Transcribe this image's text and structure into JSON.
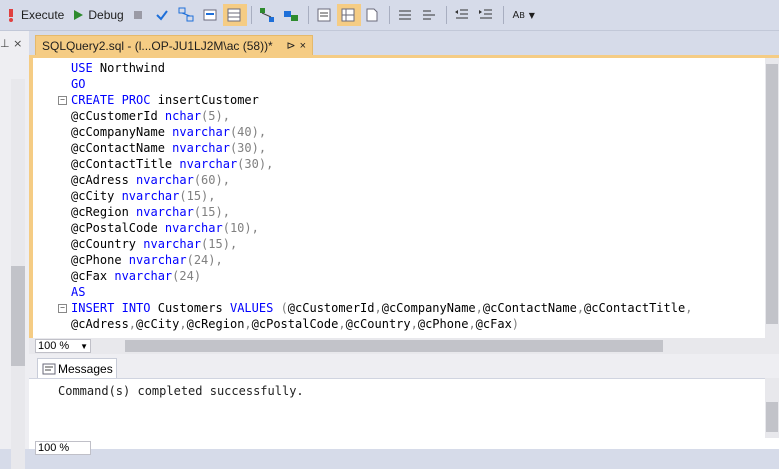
{
  "toolbar": {
    "execute_label": "Execute",
    "debug_label": "Debug",
    "icons": [
      "execute-icon",
      "debug-icon",
      "stop-icon",
      "parse-icon",
      "results-to-text-icon",
      "results-to-grid-icon",
      "results-to-file-icon",
      "include-plan-icon",
      "display-plan-icon",
      "query-options-icon",
      "intellisense-icon",
      "comment-icon",
      "uncomment-icon",
      "decrease-indent-icon",
      "increase-indent-icon",
      "specify-values-icon"
    ]
  },
  "tab": {
    "title": "SQLQuery2.sql - (l...OP-JU1LJ2M\\ac (58))*",
    "pin_glyph": "⊳",
    "close_glyph": "×"
  },
  "left_panel": {
    "header_glyphs": "⊥ ×"
  },
  "editor": {
    "lines": [
      {
        "fold": "",
        "parts": [
          {
            "t": "USE",
            "c": "kw"
          },
          {
            "t": " Northwind",
            "c": "id"
          }
        ]
      },
      {
        "fold": "",
        "parts": [
          {
            "t": "GO",
            "c": "kw"
          }
        ]
      },
      {
        "fold": "−",
        "parts": [
          {
            "t": "CREATE",
            "c": "kw"
          },
          {
            "t": " ",
            "c": "id"
          },
          {
            "t": "PROC",
            "c": "kw"
          },
          {
            "t": " insertCustomer",
            "c": "id"
          }
        ]
      },
      {
        "fold": "",
        "parts": [
          {
            "t": "@cCustomerId ",
            "c": "id"
          },
          {
            "t": "nchar",
            "c": "ty"
          },
          {
            "t": "(5),",
            "c": "pu"
          }
        ]
      },
      {
        "fold": "",
        "parts": [
          {
            "t": "@cCompanyName ",
            "c": "id"
          },
          {
            "t": "nvarchar",
            "c": "ty"
          },
          {
            "t": "(40),",
            "c": "pu"
          }
        ]
      },
      {
        "fold": "",
        "parts": [
          {
            "t": "@cContactName ",
            "c": "id"
          },
          {
            "t": "nvarchar",
            "c": "ty"
          },
          {
            "t": "(30),",
            "c": "pu"
          }
        ]
      },
      {
        "fold": "",
        "parts": [
          {
            "t": "@cContactTitle ",
            "c": "id"
          },
          {
            "t": "nvarchar",
            "c": "ty"
          },
          {
            "t": "(30),",
            "c": "pu"
          }
        ]
      },
      {
        "fold": "",
        "parts": [
          {
            "t": "@cAdress ",
            "c": "id"
          },
          {
            "t": "nvarchar",
            "c": "ty"
          },
          {
            "t": "(60),",
            "c": "pu"
          }
        ]
      },
      {
        "fold": "",
        "parts": [
          {
            "t": "@cCity ",
            "c": "id"
          },
          {
            "t": "nvarchar",
            "c": "ty"
          },
          {
            "t": "(15),",
            "c": "pu"
          }
        ]
      },
      {
        "fold": "",
        "parts": [
          {
            "t": "@cRegion ",
            "c": "id"
          },
          {
            "t": "nvarchar",
            "c": "ty"
          },
          {
            "t": "(15),",
            "c": "pu"
          }
        ]
      },
      {
        "fold": "",
        "parts": [
          {
            "t": "@cPostalCode ",
            "c": "id"
          },
          {
            "t": "nvarchar",
            "c": "ty"
          },
          {
            "t": "(10),",
            "c": "pu"
          }
        ]
      },
      {
        "fold": "",
        "parts": [
          {
            "t": "@cCountry ",
            "c": "id"
          },
          {
            "t": "nvarchar",
            "c": "ty"
          },
          {
            "t": "(15),",
            "c": "pu"
          }
        ]
      },
      {
        "fold": "",
        "parts": [
          {
            "t": "@cPhone ",
            "c": "id"
          },
          {
            "t": "nvarchar",
            "c": "ty"
          },
          {
            "t": "(24),",
            "c": "pu"
          }
        ]
      },
      {
        "fold": "",
        "parts": [
          {
            "t": "@cFax ",
            "c": "id"
          },
          {
            "t": "nvarchar",
            "c": "ty"
          },
          {
            "t": "(24)",
            "c": "pu"
          }
        ]
      },
      {
        "fold": "",
        "parts": [
          {
            "t": "AS",
            "c": "kw"
          }
        ]
      },
      {
        "fold": "−",
        "parts": [
          {
            "t": "INSERT",
            "c": "kw"
          },
          {
            "t": " ",
            "c": "id"
          },
          {
            "t": "INTO",
            "c": "kw"
          },
          {
            "t": " Customers ",
            "c": "id"
          },
          {
            "t": "VALUES",
            "c": "kw"
          },
          {
            "t": " (",
            "c": "pu"
          },
          {
            "t": "@cCustomerId",
            "c": "id"
          },
          {
            "t": ",",
            "c": "pu"
          },
          {
            "t": "@cCompanyName",
            "c": "id"
          },
          {
            "t": ",",
            "c": "pu"
          },
          {
            "t": "@cContactName",
            "c": "id"
          },
          {
            "t": ",",
            "c": "pu"
          },
          {
            "t": "@cContactTitle",
            "c": "id"
          },
          {
            "t": ",",
            "c": "pu"
          }
        ]
      },
      {
        "fold": "",
        "parts": [
          {
            "t": "@cAdress",
            "c": "id"
          },
          {
            "t": ",",
            "c": "pu"
          },
          {
            "t": "@cCity",
            "c": "id"
          },
          {
            "t": ",",
            "c": "pu"
          },
          {
            "t": "@cRegion",
            "c": "id"
          },
          {
            "t": ",",
            "c": "pu"
          },
          {
            "t": "@cPostalCode",
            "c": "id"
          },
          {
            "t": ",",
            "c": "pu"
          },
          {
            "t": "@cCountry",
            "c": "id"
          },
          {
            "t": ",",
            "c": "pu"
          },
          {
            "t": "@cPhone",
            "c": "id"
          },
          {
            "t": ",",
            "c": "pu"
          },
          {
            "t": "@cFax",
            "c": "id"
          },
          {
            "t": ")",
            "c": "pu"
          }
        ]
      }
    ],
    "zoom_value": "100 %"
  },
  "results": {
    "tab_label": "Messages",
    "message": "Command(s) completed successfully.",
    "zoom_value": "100 %"
  }
}
